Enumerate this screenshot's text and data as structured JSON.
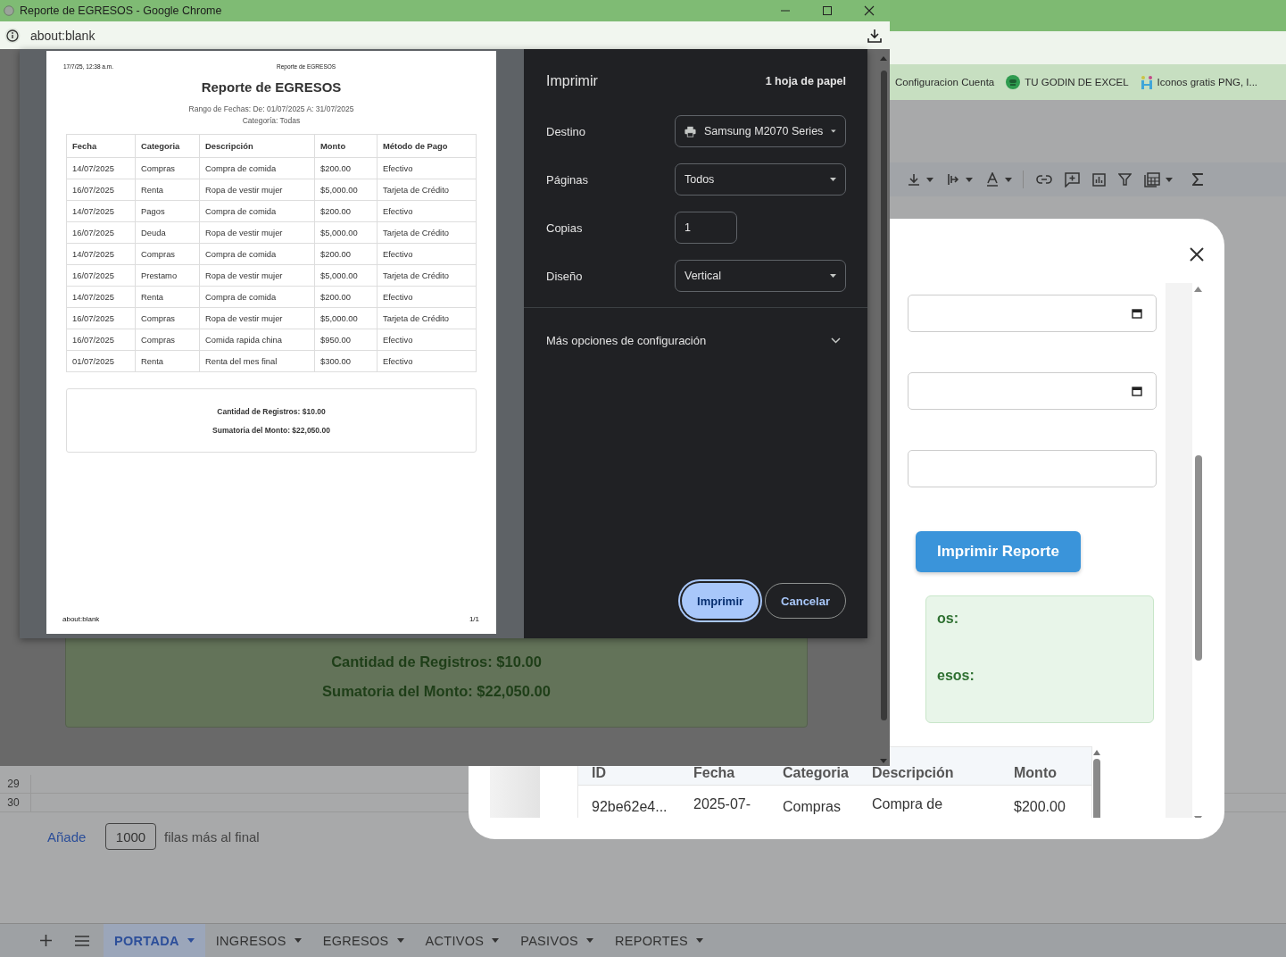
{
  "popup": {
    "title": "Reporte de EGRESOS - Google Chrome",
    "address": "about:blank",
    "print_preview": {
      "header_date": "17/7/25, 12:38 a.m.",
      "header_title": "Reporte de EGRESOS",
      "title": "Reporte de EGRESOS",
      "range": "Rango de Fechas: De: 01/07/2025 A: 31/07/2025",
      "category": "Categoría: Todas",
      "columns": [
        "Fecha",
        "Categoria",
        "Descripción",
        "Monto",
        "Método de Pago"
      ],
      "rows": [
        [
          "14/07/2025",
          "Compras",
          "Compra de comida",
          "$200.00",
          "Efectivo"
        ],
        [
          "16/07/2025",
          "Renta",
          "Ropa de vestir mujer",
          "$5,000.00",
          "Tarjeta de Crédito"
        ],
        [
          "14/07/2025",
          "Pagos",
          "Compra de comida",
          "$200.00",
          "Efectivo"
        ],
        [
          "16/07/2025",
          "Deuda",
          "Ropa de vestir mujer",
          "$5,000.00",
          "Tarjeta de Crédito"
        ],
        [
          "14/07/2025",
          "Compras",
          "Compra de comida",
          "$200.00",
          "Efectivo"
        ],
        [
          "16/07/2025",
          "Prestamo",
          "Ropa de vestir mujer",
          "$5,000.00",
          "Tarjeta de Crédito"
        ],
        [
          "14/07/2025",
          "Renta",
          "Compra de comida",
          "$200.00",
          "Efectivo"
        ],
        [
          "16/07/2025",
          "Compras",
          "Ropa de vestir mujer",
          "$5,000.00",
          "Tarjeta de Crédito"
        ],
        [
          "16/07/2025",
          "Compras",
          "Comida rapida china",
          "$950.00",
          "Efectivo"
        ],
        [
          "01/07/2025",
          "Renta",
          "Renta del mes final",
          "$300.00",
          "Efectivo"
        ]
      ],
      "summary": [
        "Cantidad de Registros: $10.00",
        "Sumatoria del Monto: $22,050.00"
      ],
      "footer_left": "about:blank",
      "footer_right": "1/1"
    },
    "print_settings": {
      "title": "Imprimir",
      "sheets": "1 hoja de papel",
      "fields": [
        {
          "label": "Destino",
          "kind": "printer",
          "value": "Samsung M2070 Series"
        },
        {
          "label": "Páginas",
          "kind": "select",
          "value": "Todos"
        },
        {
          "label": "Copias",
          "kind": "input",
          "value": "1"
        },
        {
          "label": "Diseño",
          "kind": "select",
          "value": "Vertical"
        }
      ],
      "more_options": "Más opciones de configuración",
      "buttons": [
        {
          "label": "Imprimir",
          "kind": "primary"
        },
        {
          "label": "Cancelar",
          "kind": "secondary"
        }
      ]
    },
    "page_summary": [
      "Cantidad de Registros: $10.00",
      "Sumatoria del Monto: $22,050.00"
    ]
  },
  "browser": {
    "bookmarks": [
      "Configuracion Cuenta",
      "TU GODIN DE EXCEL",
      "Iconos gratis PNG, I..."
    ]
  },
  "sheet": {
    "row_numbers": [
      "29",
      "30"
    ],
    "add_rows": {
      "link": "Añade",
      "count": "1000",
      "suffix": "filas más al final"
    },
    "tabs": [
      {
        "label": "PORTADA",
        "selected": true
      },
      {
        "label": "INGRESOS",
        "selected": false
      },
      {
        "label": "EGRESOS",
        "selected": false
      },
      {
        "label": "ACTIVOS",
        "selected": false
      },
      {
        "label": "PASIVOS",
        "selected": false
      },
      {
        "label": "REPORTES",
        "selected": false
      }
    ]
  },
  "modal": {
    "print_button": "Imprimir Reporte",
    "summary_labels": [
      "os:",
      "esos:"
    ],
    "table": {
      "columns": [
        "ID",
        "Fecha",
        "Categoria",
        "Descripción",
        "Monto"
      ],
      "rows": [
        [
          "92be62e4...",
          "2025-07-",
          "Compras",
          "Compra de",
          "$200.00"
        ]
      ]
    }
  }
}
